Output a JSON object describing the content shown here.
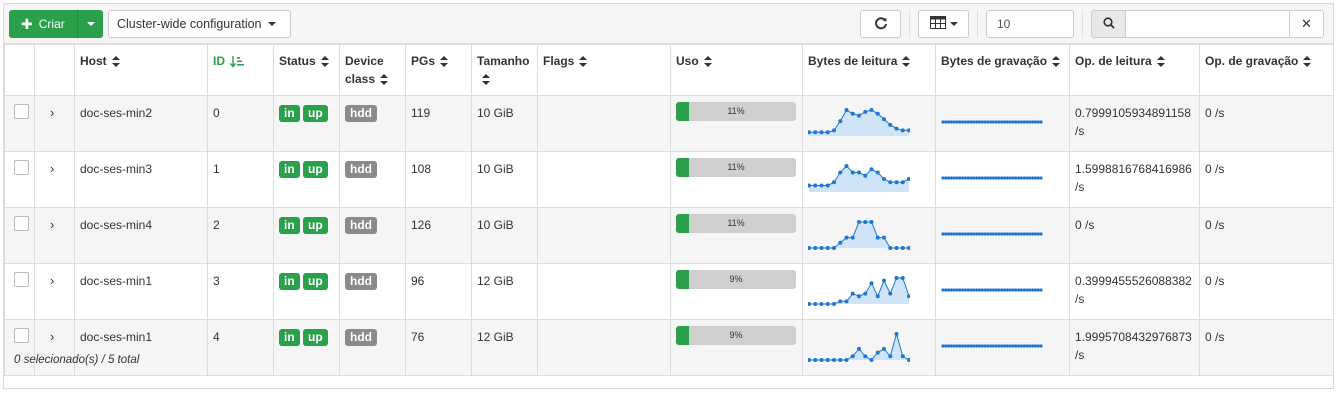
{
  "toolbar": {
    "create_label": "Criar",
    "scope_label": "Cluster-wide configuration",
    "page_size": "10",
    "search_placeholder": ""
  },
  "columns": {
    "host": "Host",
    "id": "ID",
    "status": "Status",
    "device_class": "Device class",
    "pgs": "PGs",
    "size": "Tamanho",
    "flags": "Flags",
    "usage": "Uso",
    "read_bytes": "Bytes de leitura",
    "write_bytes": "Bytes de gravação",
    "read_ops": "Op. de leitura",
    "write_ops": "Op. de gravação"
  },
  "rows": [
    {
      "host": "doc-ses-min2",
      "id": "0",
      "status_in": "in",
      "status_up": "up",
      "device_class": "hdd",
      "pgs": "119",
      "size": "10 GiB",
      "flags": "",
      "usage_text": "11%",
      "usage": 0.11,
      "read_ops": "0.7999105934891158 /s",
      "write_ops": "0 /s",
      "read_series": [
        2,
        2,
        2,
        2,
        3,
        8,
        14,
        12,
        11,
        13,
        14,
        12,
        9,
        6,
        4,
        3,
        3
      ]
    },
    {
      "host": "doc-ses-min3",
      "id": "1",
      "status_in": "in",
      "status_up": "up",
      "device_class": "hdd",
      "pgs": "108",
      "size": "10 GiB",
      "flags": "",
      "usage_text": "11%",
      "usage": 0.11,
      "read_ops": "1.5998816768416986 /s",
      "write_ops": "0 /s",
      "read_series": [
        2,
        2,
        2,
        2,
        3,
        6,
        8,
        6,
        6,
        5,
        7,
        6,
        4,
        3,
        3,
        3,
        4
      ]
    },
    {
      "host": "doc-ses-min4",
      "id": "2",
      "status_in": "in",
      "status_up": "up",
      "device_class": "hdd",
      "pgs": "126",
      "size": "10 GiB",
      "flags": "",
      "usage_text": "11%",
      "usage": 0.11,
      "read_ops": "0 /s",
      "write_ops": "0 /s",
      "read_series": [
        0,
        0,
        0,
        0,
        0,
        1,
        2,
        2,
        5,
        5,
        5,
        2,
        2,
        0,
        0,
        0,
        0
      ]
    },
    {
      "host": "doc-ses-min1",
      "id": "3",
      "status_in": "in",
      "status_up": "up",
      "device_class": "hdd",
      "pgs": "96",
      "size": "12 GiB",
      "flags": "",
      "usage_text": "9%",
      "usage": 0.09,
      "read_ops": "0.3999455526088382 /s",
      "write_ops": "0 /s",
      "read_series": [
        0,
        0,
        0,
        0,
        0,
        1,
        1,
        4,
        3,
        4,
        8,
        3,
        9,
        4,
        10,
        10,
        3
      ]
    },
    {
      "host": "doc-ses-min1",
      "id": "4",
      "status_in": "in",
      "status_up": "up",
      "device_class": "hdd",
      "pgs": "76",
      "size": "12 GiB",
      "flags": "",
      "usage_text": "9%",
      "usage": 0.09,
      "read_ops": "1.9995708432976873 /s",
      "write_ops": "0 /s",
      "read_series": [
        0,
        0,
        0,
        0,
        0,
        0,
        0,
        1,
        3,
        1,
        0,
        2,
        3,
        1,
        7,
        1,
        0
      ]
    }
  ],
  "footer": {
    "selection": "0 selecionado(s) / 5 total"
  },
  "colors": {
    "accent": "#2ba04a",
    "spark_line": "#1f77d4",
    "spark_fill": "#cfe4f7"
  },
  "icons": [
    "plus-icon",
    "caret-down-icon",
    "refresh-icon",
    "table-columns-icon",
    "search-icon",
    "close-icon",
    "sort-icon",
    "sort-amount-asc-icon",
    "chevron-right-icon"
  ]
}
